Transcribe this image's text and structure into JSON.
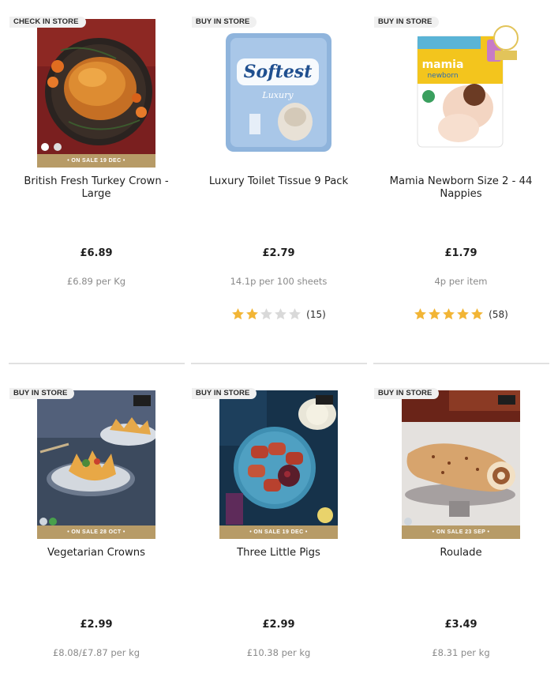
{
  "products": [
    {
      "badge": "CHECK IN STORE",
      "name": "British Fresh Turkey Crown - Large",
      "sale": "• ON SALE 19 DEC •",
      "price": "£6.89",
      "unit_price": "£6.89 per Kg",
      "image_icon": "turkey-photo"
    },
    {
      "badge": "BUY IN STORE",
      "name": "Luxury Toilet Tissue 9 Pack",
      "price": "£2.79",
      "unit_price": "14.1p per 100 sheets",
      "rating": 2,
      "reviews": "(15)",
      "image_icon": "toilet-tissue-photo",
      "pack_brand": "Softest",
      "pack_sub": "Luxury"
    },
    {
      "badge": "BUY IN STORE",
      "name": "Mamia Newborn Size 2 - 44 Nappies",
      "price": "£1.79",
      "unit_price": "4p per item",
      "rating": 5,
      "reviews": "(58)",
      "image_icon": "nappies-photo",
      "pack_brand": "mamia",
      "pack_sub": "newborn"
    },
    {
      "badge": "BUY IN STORE",
      "name": "Vegetarian Crowns",
      "sale": "• ON SALE 28 OCT •",
      "price": "£2.99",
      "unit_price": "£8.08/£7.87 per kg",
      "image_icon": "vegetarian-crowns-photo"
    },
    {
      "badge": "BUY IN STORE",
      "name": "Three Little Pigs",
      "sale": "• ON SALE 19 DEC •",
      "price": "£2.99",
      "unit_price": "£10.38 per kg",
      "image_icon": "pigs-in-blankets-photo"
    },
    {
      "badge": "BUY IN STORE",
      "name": "Roulade",
      "sale": "• ON SALE 23 SEP •",
      "price": "£3.49",
      "unit_price": "£8.31 per kg",
      "image_icon": "roulade-photo"
    }
  ],
  "colors": {
    "star_filled": "#f2b535",
    "star_empty": "#d9d9d9",
    "sale_bar": "#b79b67",
    "badge_bg": "#f0f0f0"
  }
}
